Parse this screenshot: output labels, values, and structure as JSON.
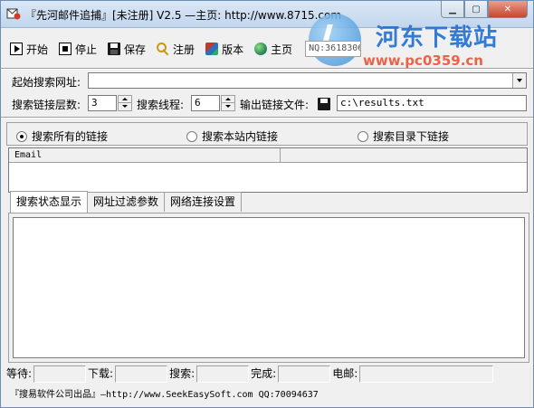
{
  "window": {
    "title": "『先河邮件追捕』[未注册] V2.5 —主页: http://www.8715.com"
  },
  "watermark": {
    "title": "河东下载站",
    "url": "www.pc0359.cn"
  },
  "toolbar": {
    "start_label": "开始",
    "stop_label": "停止",
    "save_label": "保存",
    "register_label": "注册",
    "version_label": "版本",
    "home_label": "主页",
    "qq_value": "NQ:3618306657"
  },
  "form": {
    "start_url_label": "起始搜索网址:",
    "start_url_value": "",
    "depth_label": "搜索链接层数:",
    "depth_value": "3",
    "threads_label": "搜索线程:",
    "threads_value": "6",
    "output_label": "输出链接文件:",
    "output_value": "c:\\results.txt"
  },
  "scope": {
    "options": [
      {
        "label": "搜索所有的链接",
        "selected": true
      },
      {
        "label": "搜索本站内链接",
        "selected": false
      },
      {
        "label": "搜索目录下链接",
        "selected": false
      }
    ]
  },
  "list": {
    "columns": [
      "Email",
      ""
    ]
  },
  "tabs": [
    "搜索状态显示",
    "网址过滤参数",
    "网络连接设置"
  ],
  "status": {
    "waiting_label": "等待:",
    "download_label": "下载:",
    "search_label": "搜索:",
    "done_label": "完成:",
    "email_label": "电邮:"
  },
  "footer": "『搜易软件公司出品』—http://www.SeekEasySoft.com QQ:70094637"
}
